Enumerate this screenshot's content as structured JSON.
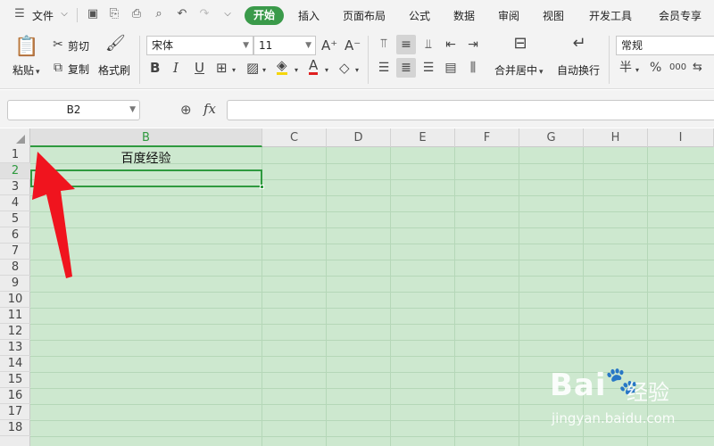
{
  "menubar": {
    "file_label": "文件",
    "tabs": [
      "开始",
      "插入",
      "页面布局",
      "公式",
      "数据",
      "审阅",
      "视图",
      "开发工具",
      "会员专享"
    ]
  },
  "ribbon": {
    "paste": "粘贴",
    "cut": "剪切",
    "copy": "复制",
    "format_painter": "格式刷",
    "font_name": "宋体",
    "font_size": "11",
    "merge_center": "合并居中",
    "wrap_text": "自动换行",
    "number_format": "常规",
    "currency_symbol": "半",
    "percent_symbol": "%",
    "thousands_symbol": "000"
  },
  "formula_bar": {
    "name_box": "B2",
    "fx": "fx",
    "content": ""
  },
  "sheet": {
    "columns": [
      "B",
      "C",
      "D",
      "E",
      "F",
      "G",
      "H",
      "I"
    ],
    "rows": [
      "1",
      "2",
      "3",
      "4",
      "5",
      "6",
      "7",
      "8",
      "9",
      "10",
      "11",
      "12",
      "13",
      "14",
      "15",
      "16",
      "17",
      "18"
    ],
    "cell_b1": "百度经验",
    "selected_cell": "B2"
  },
  "watermark": {
    "brand": "Bai",
    "brand_cn": "经验",
    "url": "jingyan.baidu.com"
  },
  "colors": {
    "accent": "#3a9a4a",
    "grid_bg": "#cde8cf",
    "arrow": "#f0141e"
  }
}
